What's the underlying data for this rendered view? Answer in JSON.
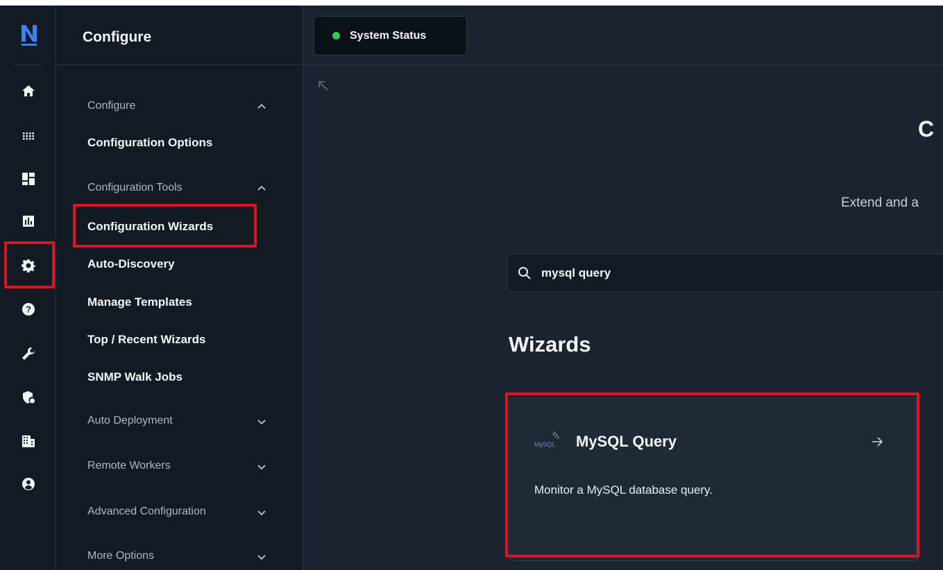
{
  "sidebar": {
    "title": "Configure",
    "sections": [
      {
        "label": "Configure",
        "expanded": true,
        "items": [
          "Configuration Options"
        ]
      },
      {
        "label": "Configuration Tools",
        "expanded": true,
        "items": [
          "Configuration Wizards",
          "Auto-Discovery",
          "Manage Templates",
          "Top / Recent Wizards",
          "SNMP Walk Jobs"
        ]
      },
      {
        "label": "Auto Deployment",
        "expanded": false,
        "items": []
      },
      {
        "label": "Remote Workers",
        "expanded": false,
        "items": []
      },
      {
        "label": "Advanced Configuration",
        "expanded": false,
        "items": []
      },
      {
        "label": "More Options",
        "expanded": false,
        "items": []
      }
    ]
  },
  "rail": {
    "logo": "N",
    "icons": [
      "home-icon",
      "grid-icon",
      "dashboard-icon",
      "reports-icon",
      "gear-icon",
      "help-icon",
      "wrench-icon",
      "shield-lock-icon",
      "building-icon",
      "user-icon"
    ],
    "active": "gear-icon"
  },
  "topbar": {
    "status_label": "System Status",
    "status_color": "#34c759"
  },
  "main": {
    "hero_title": "C",
    "hero_subtitle": "Extend and a",
    "search": {
      "value": "mysql query"
    },
    "section_heading": "Wizards",
    "wizards": [
      {
        "logo": "MySQL",
        "title": "MySQL Query",
        "description": "Monitor a MySQL database query."
      }
    ]
  },
  "colors": {
    "background": "#1b2330",
    "sidebar": "#121a24",
    "highlight": "#e0141e",
    "logo_accent": "#3b82f6"
  }
}
